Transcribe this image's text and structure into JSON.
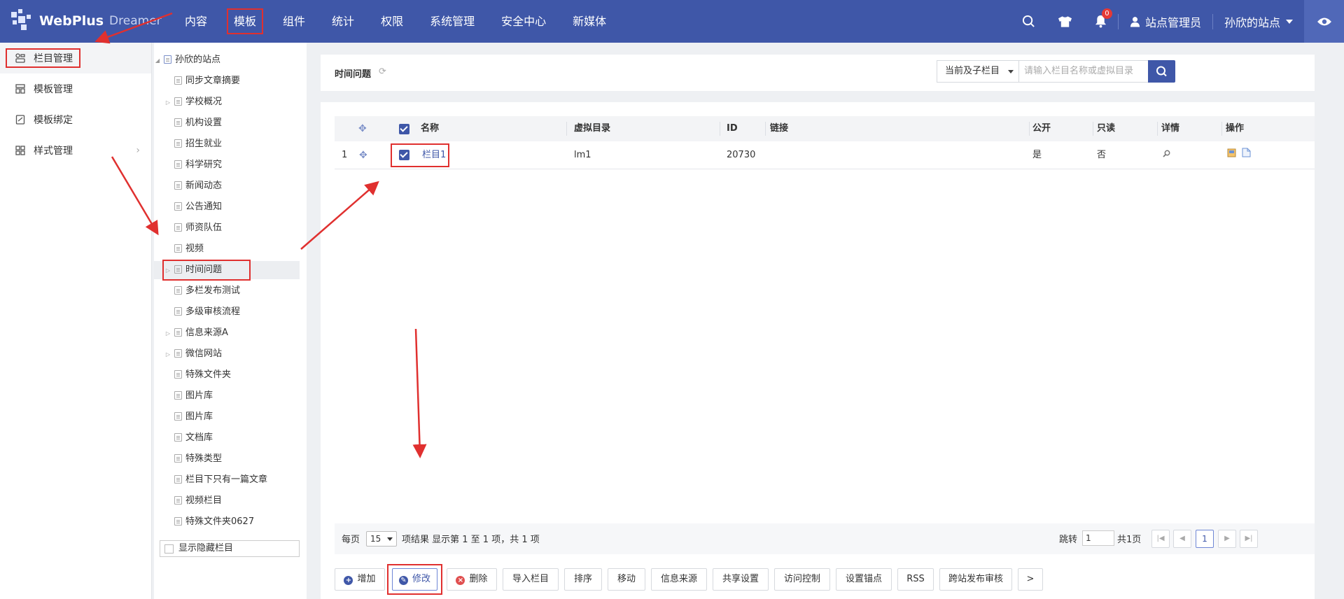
{
  "header": {
    "brand": "WebPlus",
    "product": "Dreamer",
    "nav": [
      "内容",
      "模板",
      "组件",
      "统计",
      "权限",
      "系统管理",
      "安全中心",
      "新媒体"
    ],
    "notification_count": "0",
    "user": "站点管理员",
    "site": "孙欣的站点"
  },
  "leftmenu": {
    "items": [
      {
        "label": "栏目管理",
        "icon": "columns-icon"
      },
      {
        "label": "模板管理",
        "icon": "template-icon"
      },
      {
        "label": "模板绑定",
        "icon": "bind-icon"
      },
      {
        "label": "样式管理",
        "icon": "style-icon"
      }
    ]
  },
  "tree": {
    "root": "孙欣的站点",
    "nodes": [
      {
        "label": "同步文章摘要",
        "expandable": false
      },
      {
        "label": "学校概况",
        "expandable": true
      },
      {
        "label": "机构设置",
        "expandable": false
      },
      {
        "label": "招生就业",
        "expandable": false
      },
      {
        "label": "科学研究",
        "expandable": false
      },
      {
        "label": "新闻动态",
        "expandable": false
      },
      {
        "label": "公告通知",
        "expandable": false
      },
      {
        "label": "师资队伍",
        "expandable": false
      },
      {
        "label": "视频",
        "expandable": false
      },
      {
        "label": "时间问题",
        "expandable": true
      },
      {
        "label": "多栏发布测试",
        "expandable": false
      },
      {
        "label": "多级审核流程",
        "expandable": false
      },
      {
        "label": "信息来源A",
        "expandable": true
      },
      {
        "label": "微信网站",
        "expandable": true
      },
      {
        "label": "特殊文件夹",
        "expandable": false
      },
      {
        "label": "图片库",
        "expandable": false
      },
      {
        "label": "图片库",
        "expandable": false
      },
      {
        "label": "文档库",
        "expandable": false
      },
      {
        "label": "特殊类型",
        "expandable": false
      },
      {
        "label": "栏目下只有一篇文章",
        "expandable": false
      },
      {
        "label": "视频栏目",
        "expandable": false
      },
      {
        "label": "特殊文件夹0627",
        "expandable": false
      }
    ],
    "show_hidden_label": "显示隐藏栏目"
  },
  "content": {
    "title": "时间问题",
    "scope_select": "当前及子栏目",
    "search_placeholder": "请输入栏目名称或虚拟目录",
    "columns": {
      "name": "名称",
      "vdir": "虚拟目录",
      "id": "ID",
      "link": "链接",
      "public": "公开",
      "readonly": "只读",
      "detail": "详情",
      "ops": "操作"
    },
    "rows": [
      {
        "index": "1",
        "name": "栏目1",
        "vdir": "lm1",
        "id": "20730",
        "link": "",
        "public": "是",
        "readonly": "否"
      }
    ]
  },
  "pager": {
    "per_page_label": "每页",
    "per_page": "15",
    "summary": "项结果 显示第 1 至 1 项，共 1 项",
    "jump_label": "跳转",
    "jump_value": "1",
    "total_pages": "共1页",
    "current": "1"
  },
  "actions": {
    "add": "增加",
    "edit": "修改",
    "delete": "删除",
    "import": "导入栏目",
    "sort": "排序",
    "move": "移动",
    "source": "信息来源",
    "share": "共享设置",
    "access": "访问控制",
    "anchor": "设置锚点",
    "rss": "RSS",
    "cross": "跨站发布审核",
    "more": ">"
  },
  "colors": {
    "brand": "#3f57a8",
    "highlight": "#e0302f"
  }
}
